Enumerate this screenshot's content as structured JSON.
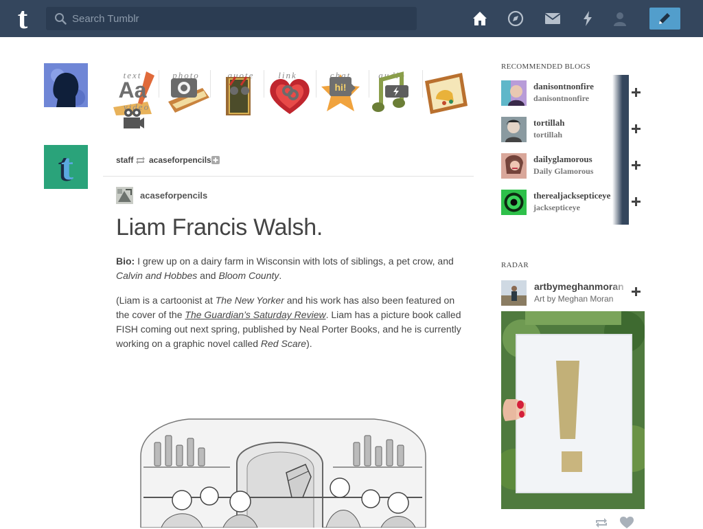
{
  "header": {
    "logo_letter": "t",
    "search_placeholder": "Search Tumblr",
    "nav_icons": [
      "home-icon",
      "explore-icon",
      "inbox-icon",
      "activity-icon",
      "account-icon"
    ],
    "compose_icon": "pencil-icon",
    "colors": {
      "bar": "#34465d",
      "search": "#2b3c52",
      "compose": "#529ecc"
    }
  },
  "post_types": [
    {
      "label": "text",
      "glyph": "Aa"
    },
    {
      "label": "photo",
      "glyph": ""
    },
    {
      "label": "quote",
      "glyph": ""
    },
    {
      "label": "link",
      "glyph": ""
    },
    {
      "label": "chat",
      "glyph": "hi!"
    },
    {
      "label": "audio",
      "glyph": ""
    },
    {
      "label": "video",
      "glyph": ""
    }
  ],
  "post": {
    "reblogged_by": "staff",
    "reblogged_from": "acaseforpencils",
    "author": "acaseforpencils",
    "title": "Liam Francis Walsh.",
    "bio_label": "Bio:",
    "bio_text_1": " I grew up on a dairy farm in Wisconsin with lots of siblings, a pet crow, and ",
    "bio_italic_1": "Calvin and Hobbes",
    "bio_text_2": " and ",
    "bio_italic_2": "Bloom County",
    "bio_text_3": ".",
    "p2_text_1": "(Liam is a cartoonist at ",
    "p2_italic_1": "The New Yorker",
    "p2_text_2": " and his work has also been featured on the cover of the ",
    "p2_link_1": "The Guardian’s Saturday Review",
    "p2_text_3": ". Liam has a picture book called FISH coming out next spring, published by Neal Porter Books, and he is currently working on a graphic novel called ",
    "p2_italic_2": "Red Scare",
    "p2_text_4": ")."
  },
  "sidebar": {
    "recommended_heading": "RECOMMENDED BLOGS",
    "recommended": [
      {
        "name": "danisontnonfire",
        "title": "danisontnonfire"
      },
      {
        "name": "tortillah",
        "title": "tortillah"
      },
      {
        "name": "dailyglamorous",
        "title": "Daily Glamorous"
      },
      {
        "name": "therealjacksepticeye",
        "title": "jacksepticeye"
      }
    ],
    "radar_heading": "RADAR",
    "radar": {
      "name": "artbymeghanmoran",
      "title": "Art by Meghan Moran"
    }
  }
}
